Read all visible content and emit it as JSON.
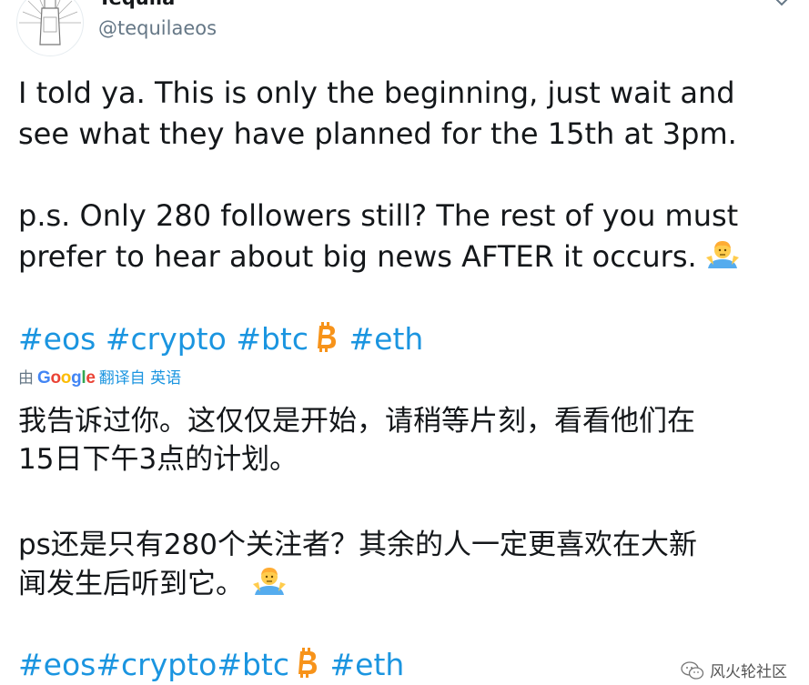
{
  "header": {
    "display_name": "Tequila",
    "handle": "@tequilaeos"
  },
  "tweet_en": {
    "line1": "I told ya. This is only the beginning, just wait and",
    "line2": "see what they have planned for the 15th at 3pm.",
    "line3": "p.s. Only 280 followers still? The rest of you must",
    "line4": "prefer to hear about big news AFTER it occurs.",
    "hashtags": [
      "#eos",
      "#crypto",
      "#btc",
      "#eth"
    ]
  },
  "translation_bar": {
    "by": "由",
    "provider": "Google",
    "translated_from": "翻译自 英语"
  },
  "tweet_zh": {
    "line1": "我告诉过你。这仅仅是开始，请稍等片刻，看看他们在",
    "line2": "15日下午3点的计划。",
    "line3": " ps还是只有280个关注者？其余的人一定更喜欢在大新",
    "line4": "闻发生后听到它。",
    "hashtags": [
      "#eos",
      "#crypto",
      "#btc",
      "#eth"
    ]
  },
  "watermark": {
    "text": "风火轮社区",
    "icon": "wechat-icon"
  },
  "icons": {
    "btc": "bitcoin-icon",
    "emoji": "man-shrugging-emoji",
    "caret": "chevron-down-icon"
  },
  "colors": {
    "link": "#1b95e0",
    "text": "#14171a",
    "muted": "#657786",
    "bitcoin": "#f7931a"
  }
}
